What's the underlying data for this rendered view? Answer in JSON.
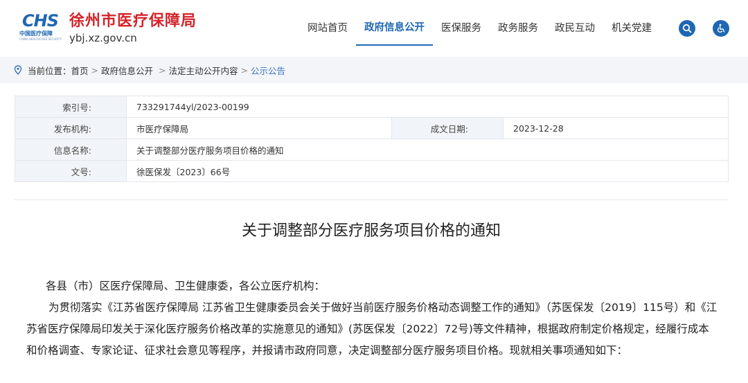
{
  "header": {
    "logo_abbr": "CHS",
    "logo_org_cn": "中国医疗保障",
    "logo_org_en": "CHINA HEALTHCARE SECURITY",
    "site_title": "徐州市医疗保障局",
    "site_domain": "ybj.xz.gov.cn",
    "nav": [
      {
        "label": "网站首页"
      },
      {
        "label": "政府信息公开"
      },
      {
        "label": "医保服务"
      },
      {
        "label": "政务服务"
      },
      {
        "label": "政民互动"
      },
      {
        "label": "机关党建"
      }
    ],
    "active_nav": 1,
    "search_icon": "search-icon",
    "accessibility_icon": "wheelchair-icon"
  },
  "breadcrumb": {
    "prefix": "当前位置：",
    "items": [
      "首页",
      "政府信息公开",
      "法定主动公开内容"
    ],
    "current": "公示公告"
  },
  "meta": {
    "index_label": "索引号:",
    "index_value": "733291744yl/2023-00199",
    "publisher_label": "发布机构:",
    "publisher_value": "市医疗保障局",
    "date_label": "成文日期:",
    "date_value": "2023-12-28",
    "name_label": "信息名称:",
    "name_value": "关于调整部分医疗服务项目价格的通知",
    "docno_label": "文号:",
    "docno_value": "徐医保发〔2023〕66号"
  },
  "article": {
    "title": "关于调整部分医疗服务项目价格的通知",
    "salutation": "各县（市）区医疗保障局、卫生健康委，各公立医疗机构：",
    "paragraph": "为贯彻落实《江苏省医疗保障局 江苏省卫生健康委员会关于做好当前医疗服务价格动态调整工作的通知》（苏医保发〔2019〕115号）和《江苏省医疗保障局印发关于深化医疗服务价格改革的实施意见的通知》(苏医保发〔2022〕72号)等文件精神，根据政府制定价格规定，经履行成本和价格调查、专家论证、征求社会意见等程序，并报请市政府同意，决定调整部分医疗服务项目价格。现就相关事项通知如下："
  },
  "colors": {
    "brand_blue": "#1f67b3",
    "title_red": "#d3242a"
  }
}
